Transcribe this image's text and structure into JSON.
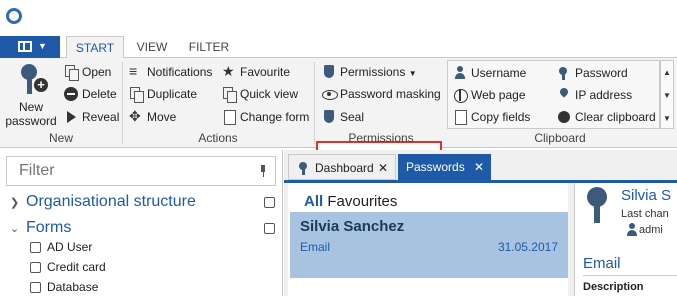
{
  "ribbon_tabs": [
    "START",
    "VIEW",
    "FILTER"
  ],
  "ribbon": {
    "new": {
      "label": "New password"
    },
    "new_group": {
      "open": "Open",
      "delete": "Delete",
      "reveal": "Reveal",
      "label": "New"
    },
    "actions": {
      "notifications": "Notifications",
      "duplicate": "Duplicate",
      "move": "Move",
      "favourite": "Favourite",
      "quick_view": "Quick view",
      "change_form": "Change form",
      "label": "Actions"
    },
    "permissions": {
      "permissions": "Permissions",
      "password_masking": "Password masking",
      "seal": "Seal",
      "label": "Permissions"
    },
    "clipboard": {
      "username": "Username",
      "web_page": "Web page",
      "copy_fields": "Copy fields",
      "password": "Password",
      "ip_address": "IP address",
      "clear_clipboard": "Clear clipboard",
      "label": "Clipboard"
    }
  },
  "filter": {
    "placeholder": "Filter",
    "sections": [
      {
        "label": "Organisational structure"
      },
      {
        "label": "Forms",
        "items": [
          "AD User",
          "Credit card",
          "Database"
        ]
      }
    ]
  },
  "doc_tabs": [
    {
      "label": "Dashboard",
      "active": false
    },
    {
      "label": "Passwords",
      "active": true
    }
  ],
  "list": {
    "heading_all": "All",
    "heading_fav": "Favourites",
    "records": [
      {
        "name": "Silvia Sanchez",
        "type": "Email",
        "date": "31.05.2017"
      }
    ]
  },
  "detail": {
    "name": "Silvia S",
    "subtitle": "Last chan",
    "user": "admi",
    "section": "Email",
    "description_label": "Description"
  },
  "colors": {
    "accent": "#1e5aa8",
    "highlight_border": "#e0302a",
    "selected_row": "#a7c3df"
  }
}
